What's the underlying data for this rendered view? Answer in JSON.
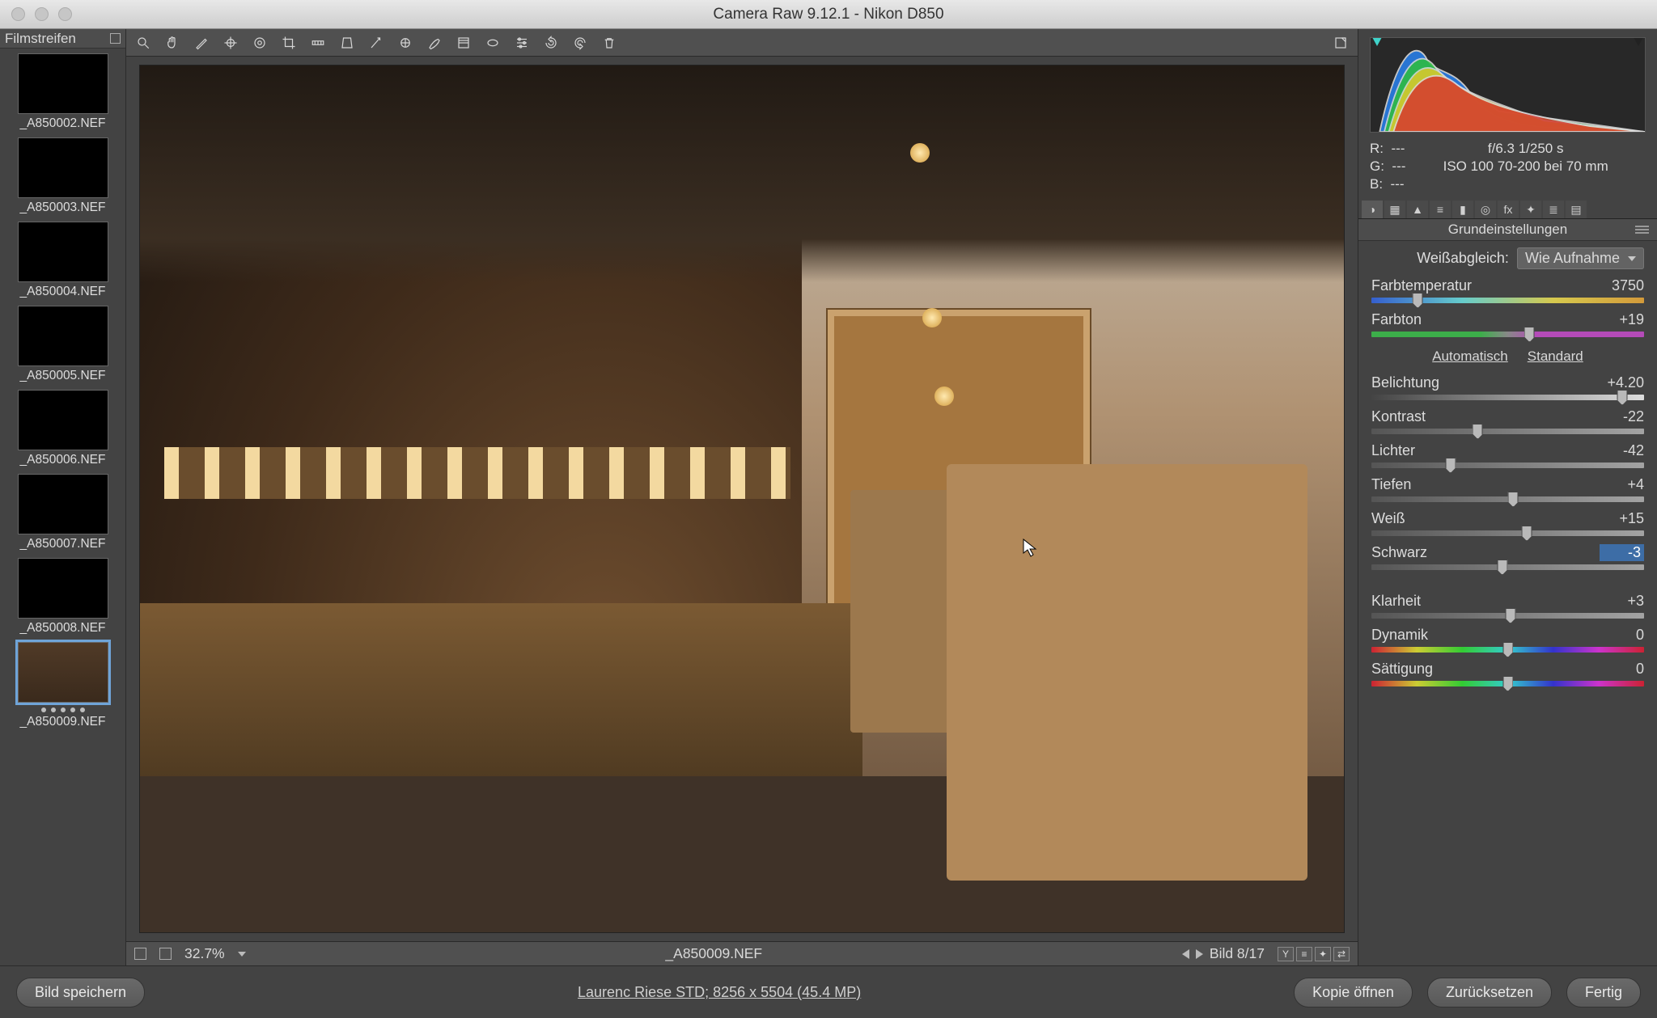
{
  "window": {
    "title": "Camera Raw 9.12.1 - Nikon D850"
  },
  "filmstrip": {
    "header": "Filmstreifen",
    "items": [
      {
        "label": "_A850002.NEF"
      },
      {
        "label": "_A850003.NEF"
      },
      {
        "label": "_A850004.NEF"
      },
      {
        "label": "_A850005.NEF"
      },
      {
        "label": "_A850006.NEF"
      },
      {
        "label": "_A850007.NEF"
      },
      {
        "label": "_A850008.NEF"
      },
      {
        "label": "_A850009.NEF",
        "selected": true
      }
    ]
  },
  "status": {
    "zoom": "32.7%",
    "filename": "_A850009.NEF",
    "pager": "Bild 8/17"
  },
  "meta": {
    "r_label": "R:",
    "g_label": "G:",
    "b_label": "B:",
    "r": "---",
    "g": "---",
    "b": "---",
    "line1": "f/6.3   1/250 s",
    "line2": "ISO 100   70-200 bei 70 mm"
  },
  "panel": {
    "title": "Grundeinstellungen",
    "wb_label": "Weißabgleich:",
    "wb_value": "Wie Aufnahme",
    "sliders": {
      "temp": {
        "label": "Farbtemperatur",
        "value": "3750",
        "pos": 17
      },
      "tint": {
        "label": "Farbton",
        "value": "+19",
        "pos": 58
      },
      "exp": {
        "label": "Belichtung",
        "value": "+4.20",
        "pos": 92
      },
      "con": {
        "label": "Kontrast",
        "value": "-22",
        "pos": 39
      },
      "high": {
        "label": "Lichter",
        "value": "-42",
        "pos": 29
      },
      "shad": {
        "label": "Tiefen",
        "value": "+4",
        "pos": 52
      },
      "white": {
        "label": "Weiß",
        "value": "+15",
        "pos": 57
      },
      "black": {
        "label": "Schwarz",
        "value": "-3",
        "pos": 48
      },
      "clar": {
        "label": "Klarheit",
        "value": "+3",
        "pos": 51
      },
      "vib": {
        "label": "Dynamik",
        "value": "0",
        "pos": 50
      },
      "sat": {
        "label": "Sättigung",
        "value": "0",
        "pos": 50
      }
    },
    "auto_label": "Automatisch",
    "std_label": "Standard"
  },
  "footer": {
    "save": "Bild speichern",
    "dims": "Laurenc Riese STD; 8256 x 5504 (45.4 MP)",
    "open_copy": "Kopie öffnen",
    "reset": "Zurücksetzen",
    "done": "Fertig"
  }
}
